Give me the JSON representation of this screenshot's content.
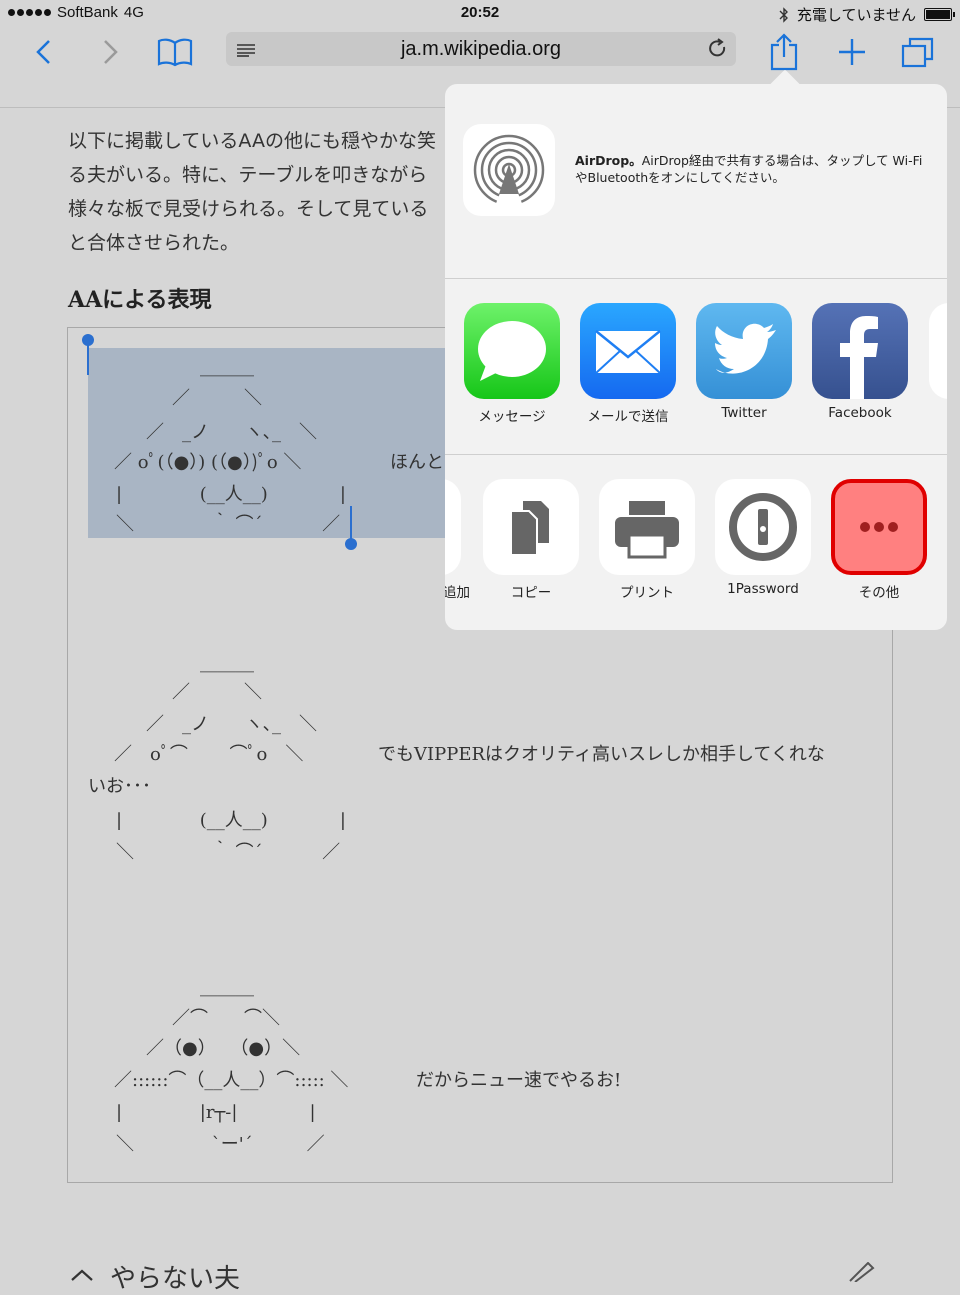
{
  "status": {
    "carrier": "SoftBank",
    "network": "4G",
    "time": "20:52",
    "charging": "充電していません"
  },
  "browser": {
    "url": "ja.m.wikipedia.org",
    "icons": [
      "back-icon",
      "forward-icon",
      "bookmarks-icon",
      "reader-icon",
      "reload-icon",
      "share-icon",
      "add-icon",
      "tabs-icon"
    ]
  },
  "article": {
    "lines": [
      "以下に掲載しているAAの他にも穏やかな笑",
      "る夫がいる。特に、テーブルを叩きながら",
      "様々な板で見受けられる。そして見ている",
      "と合体させられた。"
    ],
    "section_heading": "AAによる表現",
    "aa1": {
      "l1": "＿＿＿",
      "l2": "／　　　＼",
      "l3": "／　_ノ　　ヽ､_　＼",
      "l4": "／ oﾟ(（●）) (（●）)ﾟo ＼",
      "l4_text": "ほんと",
      "l5": "|　　　　 (__人__)　　　　|",
      "l6": "＼　　　　 ｀ ⌒´　　　 ／"
    },
    "aa2": {
      "l1": "＿＿＿",
      "l2": "／　　　＼",
      "l3": "／　_ノ　　ヽ､_　＼",
      "l4": "／　oﾟ⌒　　 ⌒ﾟo　＼",
      "l4_text": "でもVIPPERはクオリティ高いスレしか相手してくれな",
      "l4_wrap": "いお･･･",
      "l5": "|　　　　 (__人__)　　　　|",
      "l6": "＼　　　　 ｀ ⌒´　　　 ／"
    },
    "aa3": {
      "l1": "＿＿＿",
      "l2": "／⌒　　⌒＼",
      "l3": "／（●）　 （●）＼",
      "l4": "／::::::⌒（__人__）⌒::::: ＼",
      "l4_text": "だからニュー速でやるお!",
      "l5": "|　　　　 |r┬-|　　　　|",
      "l6": "＼　　　　 `ー'´　　　／"
    },
    "footer_heading": "やらない夫"
  },
  "share_sheet": {
    "airdrop_title": "AirDrop。",
    "airdrop_desc": "AirDrop経由で共有する場合は、タップして Wi-FiやBluetoothをオンにしてください。",
    "apps": [
      "メッセージ",
      "メールで送信",
      "Twitter",
      "Facebook"
    ],
    "actions": [
      "追加",
      "コピー",
      "プリント",
      "1Password",
      "その他"
    ],
    "colors": {
      "more_highlight": "#e00000",
      "more_fill": "#ff8080",
      "accent": "#1a73d9"
    }
  }
}
